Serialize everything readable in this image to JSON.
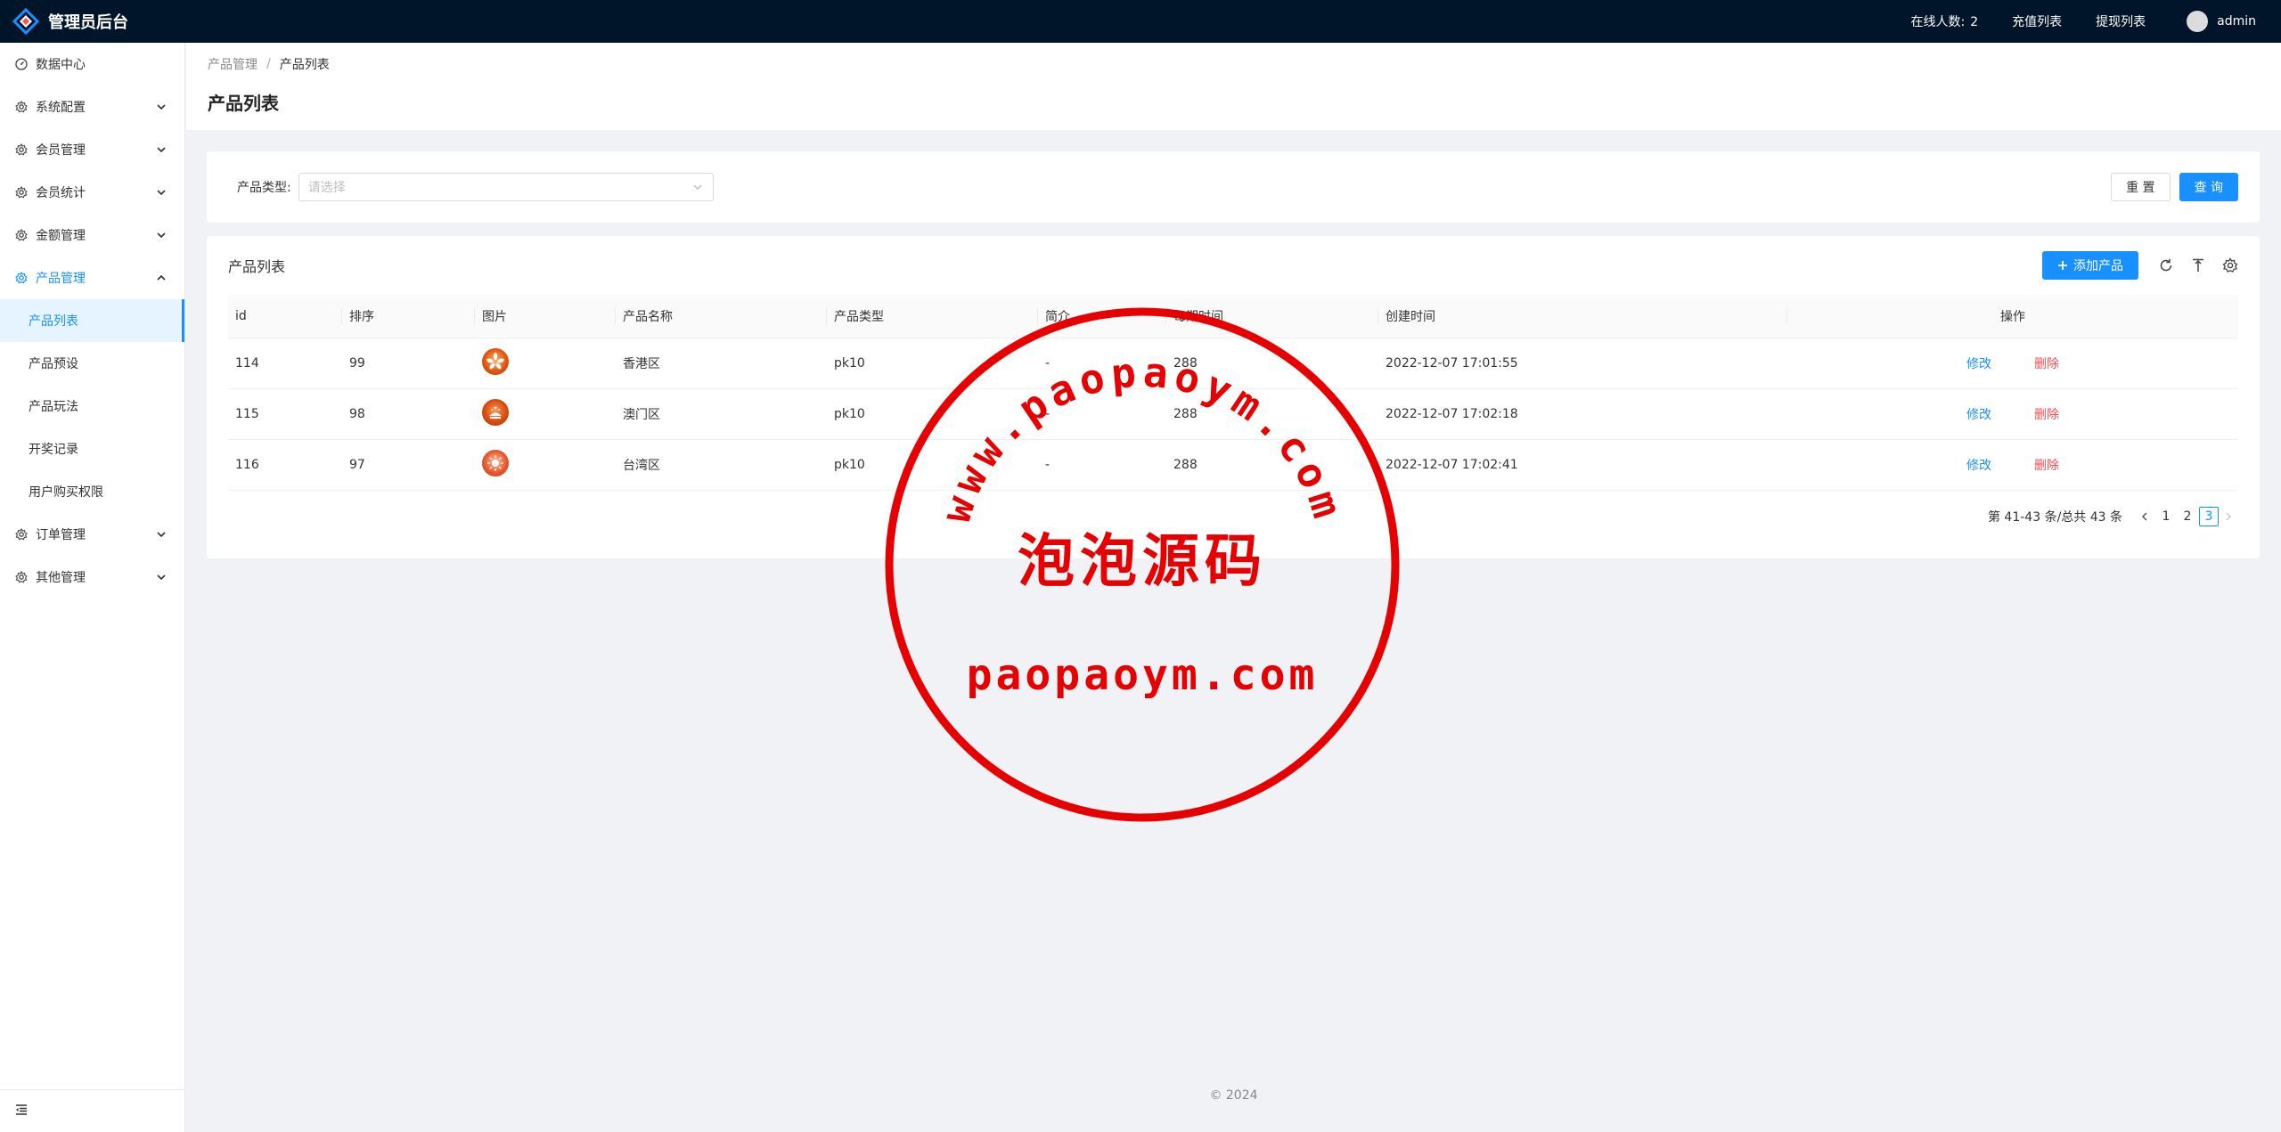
{
  "header": {
    "title": "管理员后台",
    "online_label": "在线人数:",
    "online_count": "2",
    "links": [
      "充值列表",
      "提现列表"
    ],
    "username": "admin"
  },
  "sidebar": {
    "items": [
      {
        "label": "数据中心",
        "icon": "dashboard-icon"
      },
      {
        "label": "系统配置",
        "icon": "gear-icon"
      },
      {
        "label": "会员管理",
        "icon": "gear-icon"
      },
      {
        "label": "会员统计",
        "icon": "gear-icon"
      },
      {
        "label": "金额管理",
        "icon": "gear-icon"
      },
      {
        "label": "产品管理",
        "icon": "gear-icon"
      },
      {
        "label": "订单管理",
        "icon": "gear-icon"
      },
      {
        "label": "其他管理",
        "icon": "gear-icon"
      }
    ],
    "sub_items": [
      "产品列表",
      "产品预设",
      "产品玩法",
      "开奖记录",
      "用户购买权限"
    ]
  },
  "breadcrumb": [
    "产品管理",
    "产品列表"
  ],
  "breadcrumb_sep": "/",
  "page_title": "产品列表",
  "search": {
    "label": "产品类型:",
    "placeholder": "请选择",
    "reset": "重 置",
    "query": "查 询"
  },
  "table": {
    "title": "产品列表",
    "add_button": "添加产品",
    "columns": [
      "id",
      "排序",
      "图片",
      "产品名称",
      "产品类型",
      "简介",
      "每期时间",
      "创建时间",
      "操作"
    ],
    "rows": [
      {
        "id": "114",
        "sort": "99",
        "image": "hong-kong-emblem",
        "name": "香港区",
        "type": "pk10",
        "intro": "-",
        "period": "288",
        "created": "2022-12-07 17:01:55"
      },
      {
        "id": "115",
        "sort": "98",
        "image": "macau-emblem",
        "name": "澳门区",
        "type": "pk10",
        "intro": "-",
        "period": "288",
        "created": "2022-12-07 17:02:18"
      },
      {
        "id": "116",
        "sort": "97",
        "image": "taiwan-emblem",
        "name": "台湾区",
        "type": "pk10",
        "intro": "-",
        "period": "288",
        "created": "2022-12-07 17:02:41"
      }
    ],
    "edit_label": "修改",
    "delete_label": "删除"
  },
  "pagination": {
    "summary": "第 41-43 条/总共 43 条",
    "pages": [
      "1",
      "2",
      "3"
    ],
    "current": "3"
  },
  "footer": "© 2024",
  "watermark": {
    "arc_text": "www.paopaoym.com",
    "center_text": "泡泡源码",
    "bottom_text": "paopaoym.com",
    "color": "#e60000"
  },
  "colors": {
    "header_bg": "#001529",
    "primary": "#1890ff",
    "danger": "#ff4d4f"
  }
}
